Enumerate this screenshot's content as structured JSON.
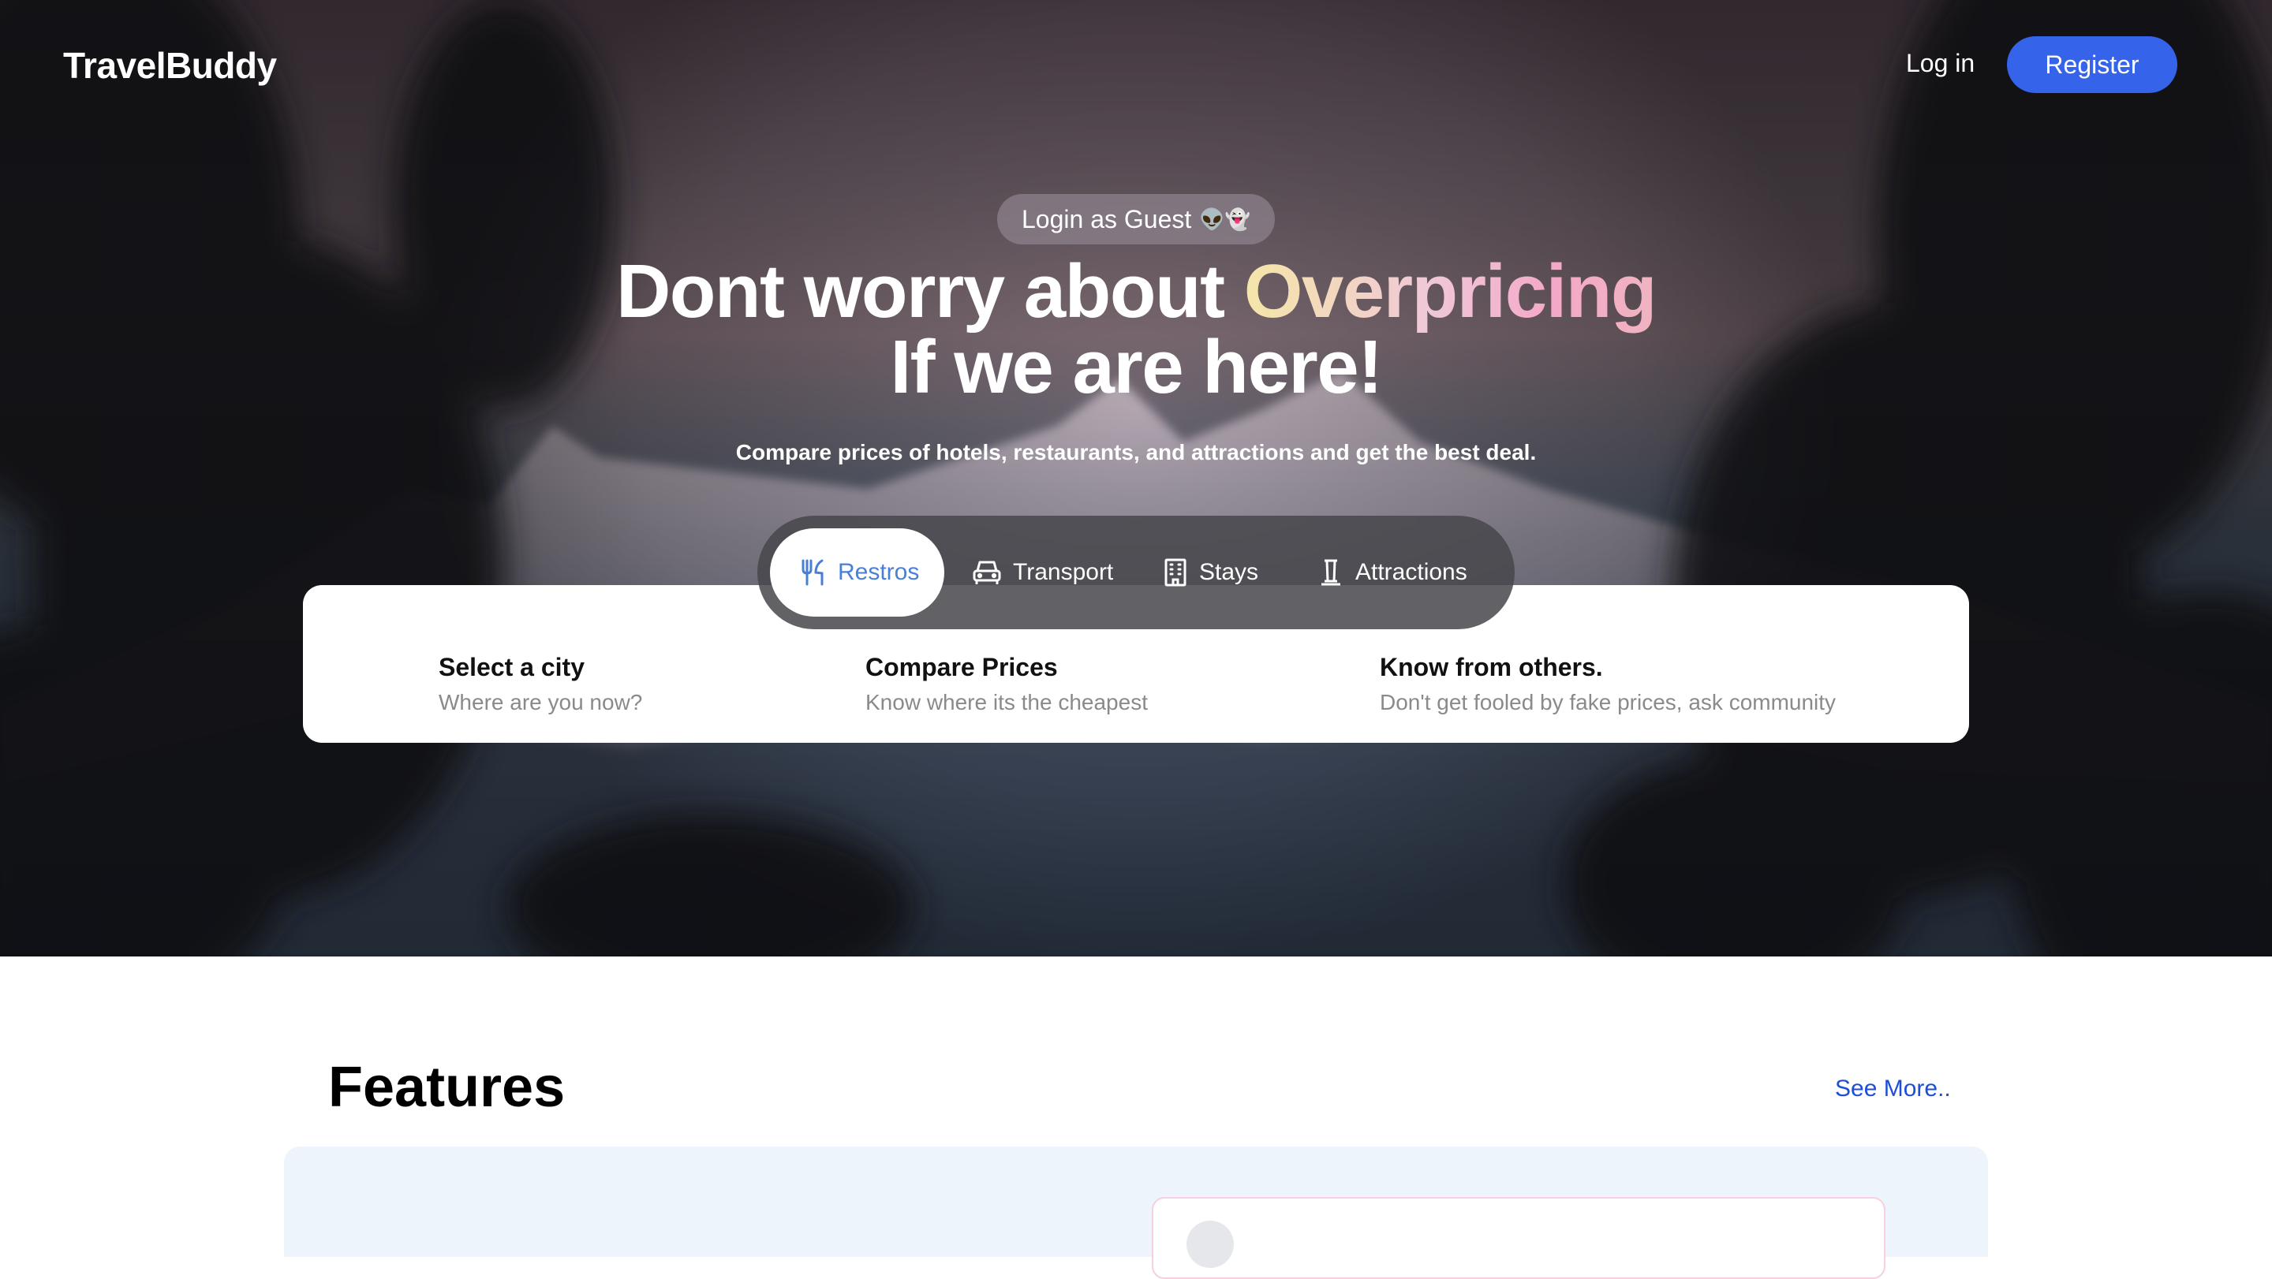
{
  "brand": {
    "name": "TravelBuddy"
  },
  "nav": {
    "login_label": "Log in",
    "register_label": "Register"
  },
  "hero": {
    "guest_label": "Login as Guest",
    "guest_emoji": "👽👻",
    "headline_part1": "Dont worry about ",
    "headline_highlight": "Overpricing",
    "headline_line2": "If we are here!",
    "subheadline": "Compare prices of hotels, restaurants, and attractions and get the best deal."
  },
  "tabs": [
    {
      "label": "Restros",
      "icon": "fork-knife-icon",
      "active": true
    },
    {
      "label": "Transport",
      "icon": "car-icon",
      "active": false
    },
    {
      "label": "Stays",
      "icon": "building-icon",
      "active": false
    },
    {
      "label": "Attractions",
      "icon": "monument-icon",
      "active": false
    }
  ],
  "steps": [
    {
      "title": "Select a city",
      "subtitle": "Where are you now?"
    },
    {
      "title": "Compare Prices",
      "subtitle": "Know where its the cheapest"
    },
    {
      "title": "Know from others.",
      "subtitle": "Don't get fooled by fake prices, ask community"
    }
  ],
  "features": {
    "title": "Features",
    "see_more_label": "See More.."
  },
  "colors": {
    "accent": "#3563e9",
    "active_tab_text": "#4a7fd6",
    "link": "#1d4ed8",
    "features_panel_bg": "#eef4fc"
  }
}
